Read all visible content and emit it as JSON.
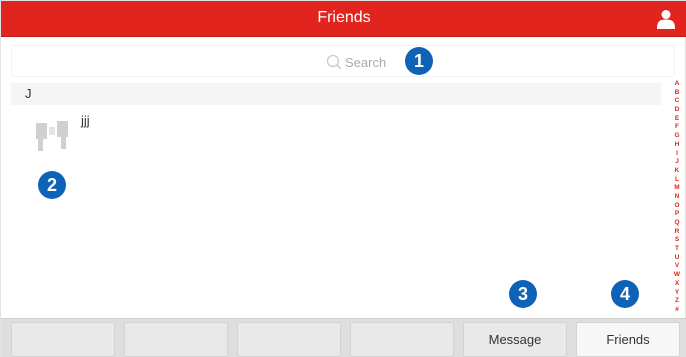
{
  "header": {
    "title": "Friends",
    "user_icon": "user-icon",
    "color": "#e1241e"
  },
  "search": {
    "placeholder": "Search",
    "icon": "search-icon"
  },
  "contacts": {
    "section_letter": "J",
    "items": [
      {
        "name": "jjj",
        "avatar_icon": "avatar-icon"
      }
    ]
  },
  "alphabet_index": [
    "A",
    "B",
    "C",
    "D",
    "E",
    "F",
    "G",
    "H",
    "I",
    "J",
    "K",
    "L",
    "M",
    "N",
    "O",
    "P",
    "Q",
    "R",
    "S",
    "T",
    "U",
    "V",
    "W",
    "X",
    "Y",
    "Z",
    "#"
  ],
  "callouts": [
    "1",
    "2",
    "3",
    "4"
  ],
  "callout_color": "#0e63b8",
  "bottom_tabs": {
    "blank_tabs": [
      "",
      "",
      "",
      ""
    ],
    "message_label": "Message",
    "friends_label": "Friends"
  }
}
